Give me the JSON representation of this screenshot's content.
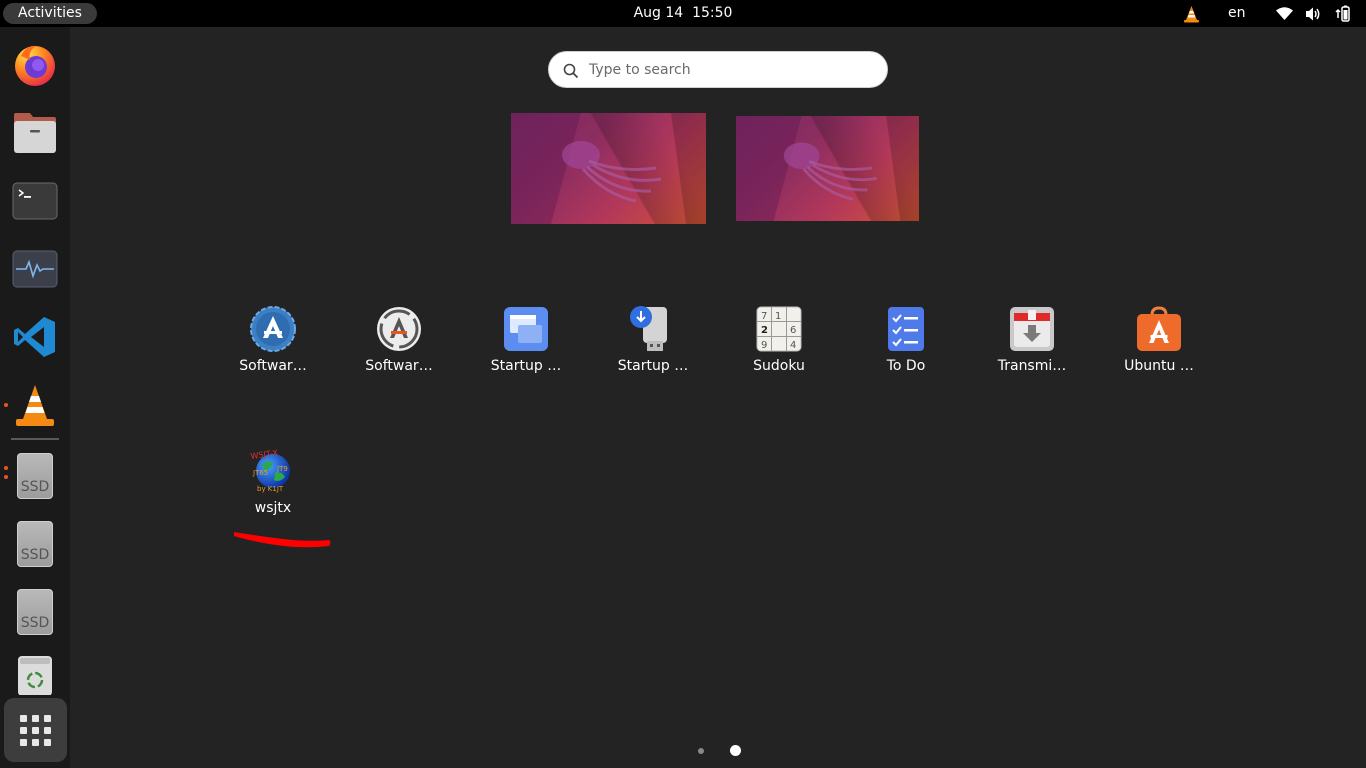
{
  "topbar": {
    "activities_label": "Activities",
    "date": "Aug 14",
    "time": "15:50",
    "language": "en",
    "tray_icons": [
      "vlc-tray-icon",
      "wifi-icon",
      "volume-icon",
      "battery-icon"
    ]
  },
  "dock": {
    "items": [
      {
        "name": "firefox",
        "icon": "firefox-icon"
      },
      {
        "name": "files",
        "icon": "files-icon"
      },
      {
        "name": "terminal",
        "icon": "terminal-icon"
      },
      {
        "name": "system-monitor",
        "icon": "system-monitor-icon"
      },
      {
        "name": "vscode",
        "icon": "vscode-icon"
      },
      {
        "name": "vlc",
        "icon": "vlc-icon",
        "running": true
      },
      {
        "name": "ssd-1",
        "icon": "drive-icon",
        "label": "SSD",
        "running": true
      },
      {
        "name": "ssd-2",
        "icon": "drive-icon",
        "label": "SSD"
      },
      {
        "name": "ssd-3",
        "icon": "drive-icon",
        "label": "SSD"
      },
      {
        "name": "trash",
        "icon": "trash-icon"
      }
    ],
    "show_apps_icon": "grid-icon"
  },
  "search": {
    "placeholder": "Type to search",
    "value": ""
  },
  "workspaces": [
    {
      "name": "workspace-1"
    },
    {
      "name": "workspace-2"
    }
  ],
  "apps": [
    {
      "label": "Softwar…",
      "icon": "software-properties-icon"
    },
    {
      "label": "Softwar…",
      "icon": "software-updater-icon"
    },
    {
      "label": "Startup …",
      "icon": "startup-applications-icon"
    },
    {
      "label": "Startup …",
      "icon": "startup-disk-creator-icon"
    },
    {
      "label": "Sudoku",
      "icon": "sudoku-icon"
    },
    {
      "label": "To Do",
      "icon": "todo-icon"
    },
    {
      "label": "Transmi…",
      "icon": "transmission-icon"
    },
    {
      "label": "Ubuntu …",
      "icon": "ubuntu-software-icon"
    },
    {
      "label": "wsjtx",
      "icon": "wsjtx-icon"
    }
  ],
  "wsjtx_icon_text": "WSJT-X JT65 JT9 by K1JT",
  "pagination": {
    "pages": 2,
    "current_page": 2
  },
  "colors": {
    "accent": "#e95420",
    "annotation": "#ff0000",
    "background": "#232323"
  }
}
